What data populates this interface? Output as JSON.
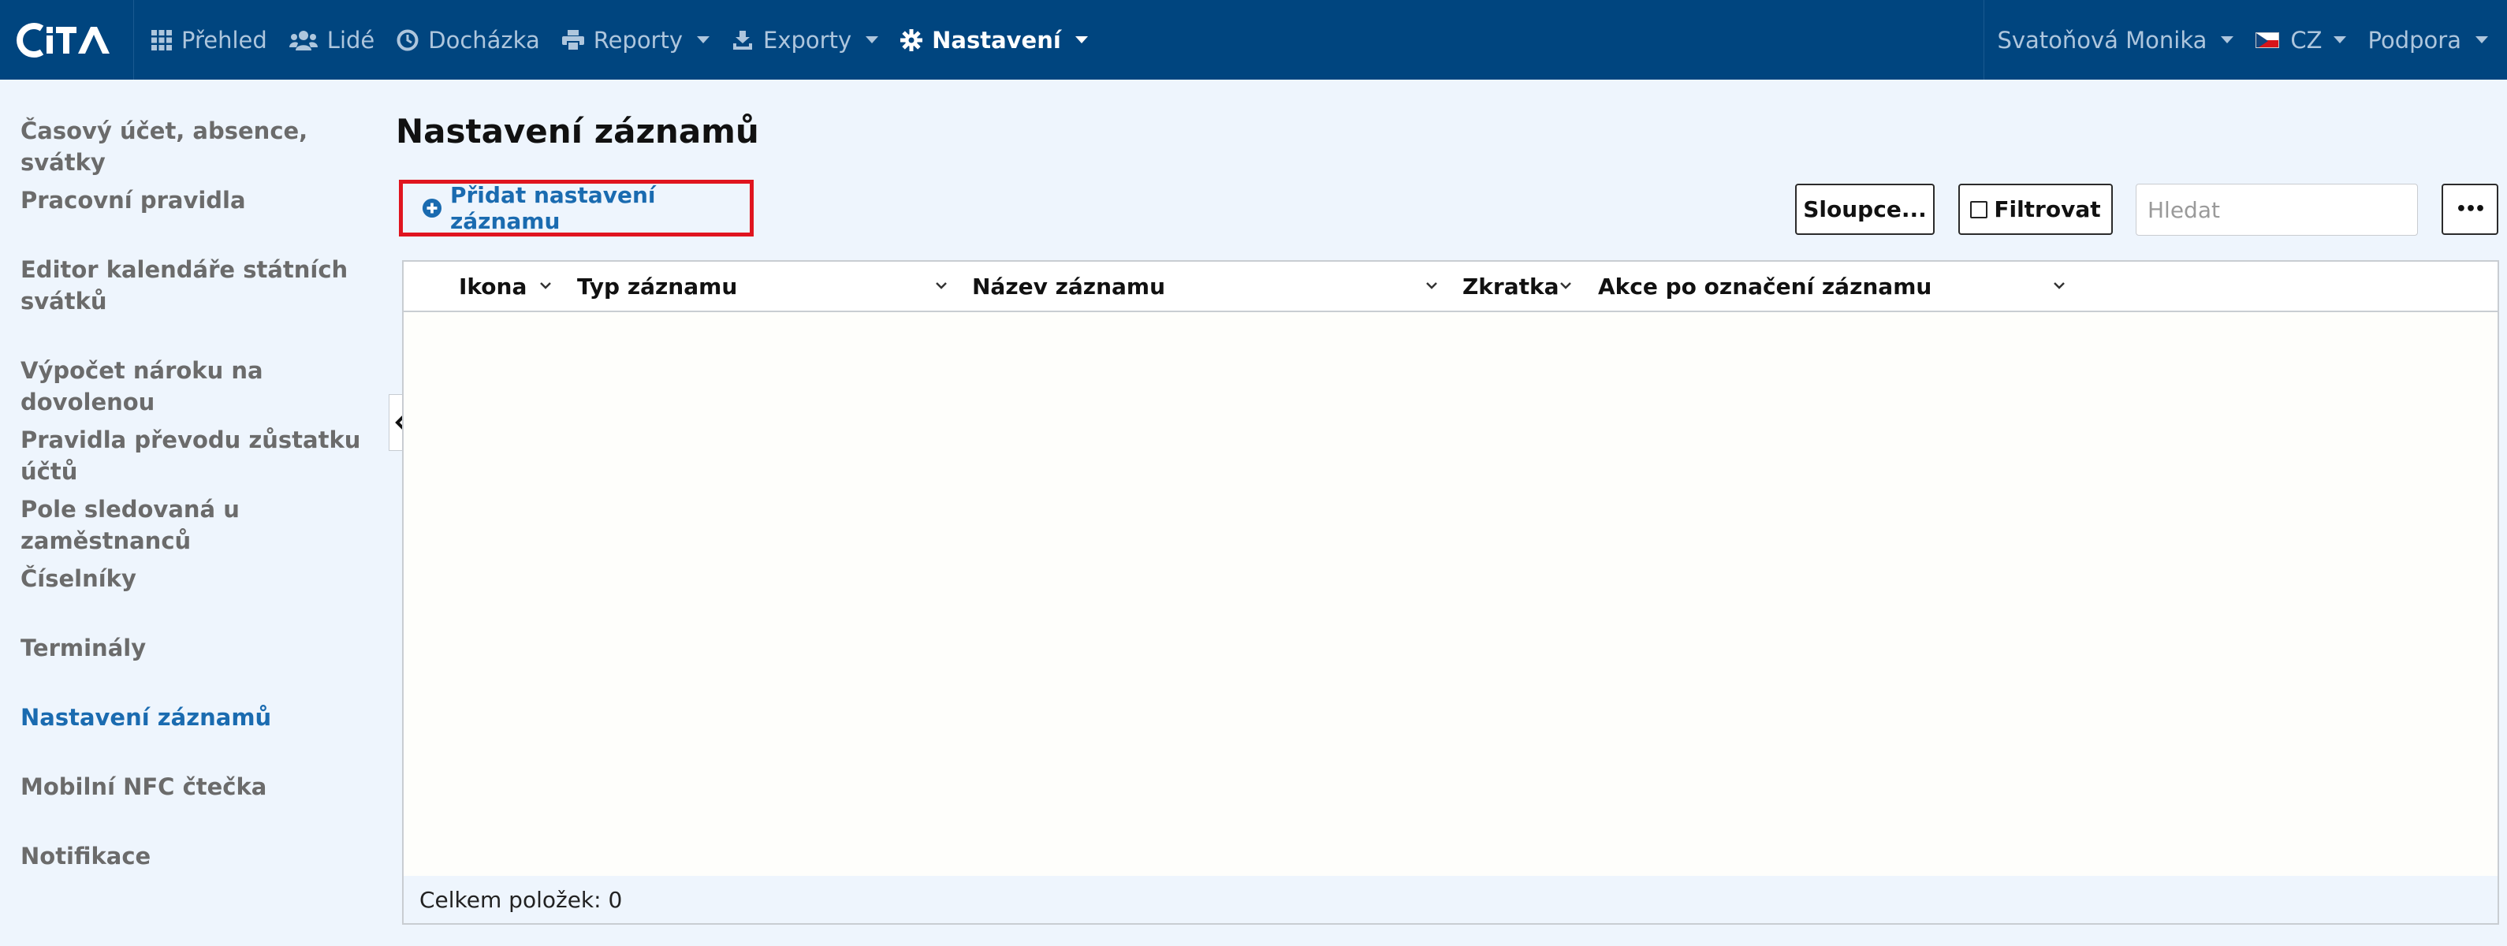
{
  "navbar": {
    "logo_text": "CiTA",
    "items": [
      {
        "label": "Přehled",
        "icon": "grid-icon"
      },
      {
        "label": "Lidé",
        "icon": "users-icon"
      },
      {
        "label": "Docházka",
        "icon": "clock-icon"
      },
      {
        "label": "Reporty",
        "icon": "print-icon",
        "dropdown": true
      },
      {
        "label": "Exporty",
        "icon": "export-icon",
        "dropdown": true
      },
      {
        "label": "Nastavení",
        "icon": "gear-icon",
        "dropdown": true,
        "active": true
      }
    ],
    "user": "Svatoňová Monika",
    "language": "CZ",
    "support": "Podpora"
  },
  "sidebar": {
    "items": [
      {
        "label": "Časový účet, absence, svátky"
      },
      {
        "label": "Pracovní pravidla"
      },
      {
        "label": "Editor kalendáře státních svátků"
      },
      {
        "label": "Výpočet nároku na dovolenou"
      },
      {
        "label": "Pravidla převodu zůstatku účtů"
      },
      {
        "label": "Pole sledovaná u zaměstnanců"
      },
      {
        "label": "Číselníky"
      },
      {
        "label": "Terminály"
      },
      {
        "label": "Nastavení záznamů",
        "active": true
      },
      {
        "label": "Mobilní NFC čtečka"
      },
      {
        "label": "Notifikace"
      }
    ]
  },
  "main": {
    "title": "Nastavení záznamů",
    "add_label": "Přidat nastavení záznamu",
    "columns_button": "Sloupce...",
    "filter_button": "Filtrovat",
    "search_placeholder": "Hledat",
    "more_button": "•••"
  },
  "grid": {
    "columns": [
      "Ikona",
      "Typ záznamu",
      "Název záznamu",
      "Zkratka",
      "Akce po označení záznamu"
    ],
    "rows": [],
    "footer": "Celkem položek: 0"
  },
  "colors": {
    "navbar_bg": "#00457f",
    "accent": "#1a6bb0",
    "highlight_border": "#e0151f",
    "page_bg": "#eef5fd"
  }
}
